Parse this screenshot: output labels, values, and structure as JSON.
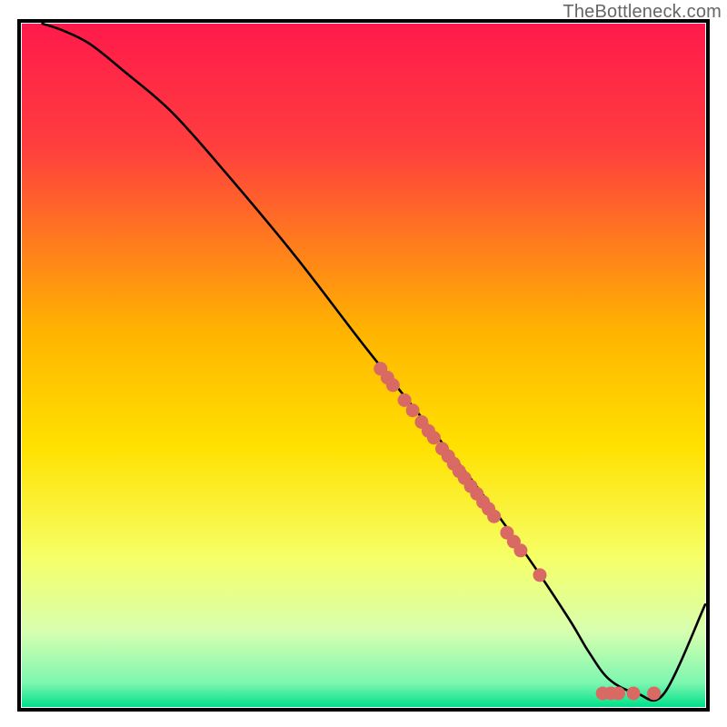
{
  "watermark": "TheBottleneck.com",
  "chart_data": {
    "type": "line",
    "title": "",
    "xlabel": "",
    "ylabel": "",
    "xlim": [
      0,
      100
    ],
    "ylim": [
      0,
      100
    ],
    "grid": false,
    "background": "heat-gradient",
    "colors": {
      "gradient_stops": [
        {
          "offset": 0.0,
          "color": "#ff1a4b"
        },
        {
          "offset": 0.18,
          "color": "#ff3e3e"
        },
        {
          "offset": 0.45,
          "color": "#ffb400"
        },
        {
          "offset": 0.62,
          "color": "#ffe100"
        },
        {
          "offset": 0.78,
          "color": "#f6ff66"
        },
        {
          "offset": 0.89,
          "color": "#d7ffb0"
        },
        {
          "offset": 0.965,
          "color": "#7cf7b0"
        },
        {
          "offset": 1.0,
          "color": "#00e08a"
        }
      ],
      "line": "#000000",
      "dot": "#d86a63"
    },
    "series": [
      {
        "name": "bottleneck-curve",
        "x": [
          3,
          6,
          10,
          15,
          22,
          30,
          40,
          50,
          58,
          66,
          74,
          80,
          83,
          86,
          90,
          94,
          100
        ],
        "y": [
          100,
          99,
          97,
          93,
          87,
          78,
          66,
          53,
          43,
          33,
          22,
          13,
          8,
          4,
          2,
          2,
          15
        ]
      }
    ],
    "scatter_points": [
      {
        "x": 52.5,
        "y": 49.5
      },
      {
        "x": 53.5,
        "y": 48.2
      },
      {
        "x": 54.3,
        "y": 47.1
      },
      {
        "x": 56.0,
        "y": 44.9
      },
      {
        "x": 57.2,
        "y": 43.4
      },
      {
        "x": 58.5,
        "y": 41.7
      },
      {
        "x": 59.5,
        "y": 40.4
      },
      {
        "x": 60.3,
        "y": 39.4
      },
      {
        "x": 61.5,
        "y": 37.8
      },
      {
        "x": 62.4,
        "y": 36.7
      },
      {
        "x": 63.2,
        "y": 35.6
      },
      {
        "x": 64.0,
        "y": 34.5
      },
      {
        "x": 64.8,
        "y": 33.5
      },
      {
        "x": 65.7,
        "y": 32.3
      },
      {
        "x": 66.6,
        "y": 31.2
      },
      {
        "x": 67.5,
        "y": 30.0
      },
      {
        "x": 68.3,
        "y": 29.0
      },
      {
        "x": 69.1,
        "y": 27.9
      },
      {
        "x": 71.0,
        "y": 25.5
      },
      {
        "x": 72.0,
        "y": 24.2
      },
      {
        "x": 73.0,
        "y": 22.9
      },
      {
        "x": 75.8,
        "y": 19.3
      },
      {
        "x": 85.0,
        "y": 2.0
      },
      {
        "x": 86.2,
        "y": 2.0
      },
      {
        "x": 87.3,
        "y": 2.0
      },
      {
        "x": 89.5,
        "y": 2.0
      },
      {
        "x": 92.5,
        "y": 2.0
      }
    ]
  }
}
